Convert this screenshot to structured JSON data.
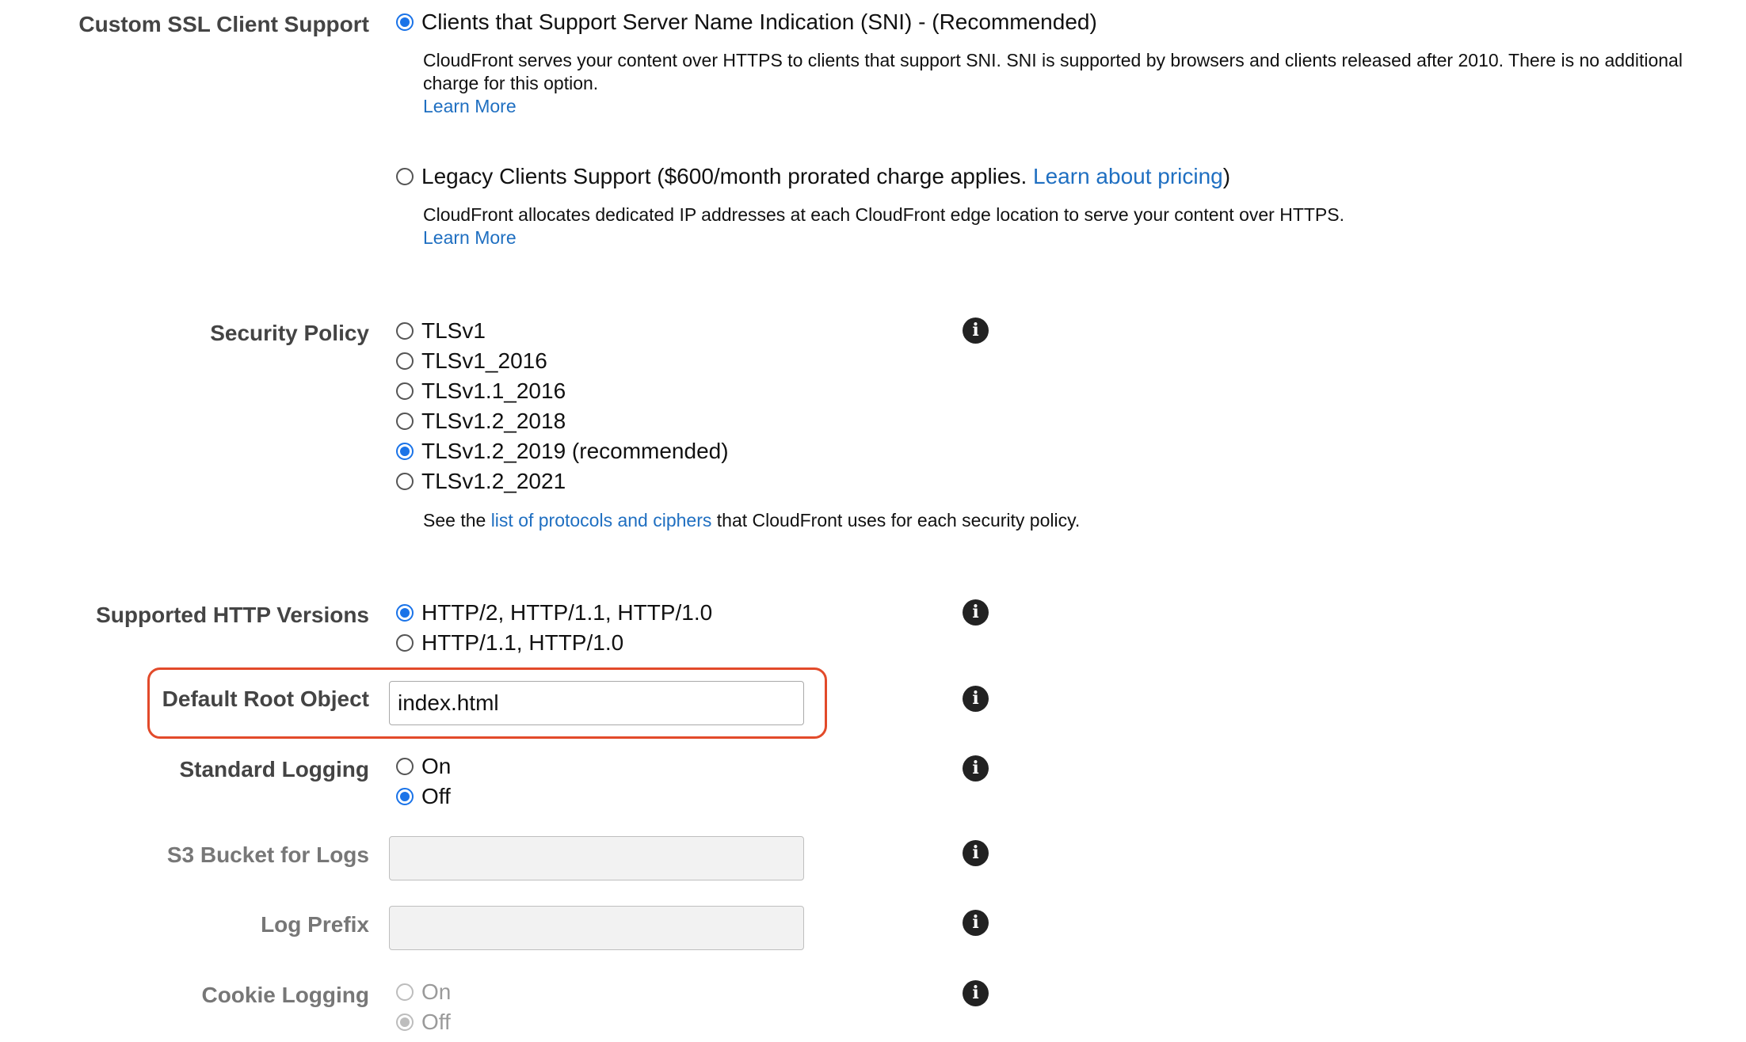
{
  "ssl_support": {
    "label": "Custom SSL Client Support",
    "sni_option": "Clients that Support Server Name Indication (SNI) - (Recommended)",
    "sni_desc": "CloudFront serves your content over HTTPS to clients that support SNI. SNI is supported by browsers and clients released after 2010. There is no additional charge for this option.",
    "sni_learn_more": "Learn More",
    "legacy_option_prefix": "Legacy Clients Support ($600/month prorated charge applies. ",
    "legacy_pricing_link": "Learn about pricing",
    "legacy_option_suffix": ")",
    "legacy_desc": "CloudFront allocates dedicated IP addresses at each CloudFront edge location to serve your content over HTTPS.",
    "legacy_learn_more": "Learn More",
    "selected": "sni"
  },
  "security_policy": {
    "label": "Security Policy",
    "options": [
      "TLSv1",
      "TLSv1_2016",
      "TLSv1.1_2016",
      "TLSv1.2_2018",
      "TLSv1.2_2019 (recommended)",
      "TLSv1.2_2021"
    ],
    "selected": "TLSv1.2_2019 (recommended)",
    "note_prefix": "See the ",
    "note_link": "list of protocols and ciphers",
    "note_suffix": " that CloudFront uses for each security policy."
  },
  "http_versions": {
    "label": "Supported HTTP Versions",
    "options": [
      "HTTP/2, HTTP/1.1, HTTP/1.0",
      "HTTP/1.1, HTTP/1.0"
    ],
    "selected": "HTTP/2, HTTP/1.1, HTTP/1.0"
  },
  "default_root_object": {
    "label": "Default Root Object",
    "value": "index.html"
  },
  "standard_logging": {
    "label": "Standard Logging",
    "on": "On",
    "off": "Off",
    "selected": "Off"
  },
  "s3_bucket": {
    "label": "S3 Bucket for Logs",
    "value": ""
  },
  "log_prefix": {
    "label": "Log Prefix",
    "value": ""
  },
  "cookie_logging": {
    "label": "Cookie Logging",
    "on": "On",
    "off": "Off",
    "selected": "Off"
  },
  "info_icon_glyph": "i",
  "colors": {
    "accent": "#1a73e8",
    "link": "#1f6fc1",
    "highlight": "#e24a2a"
  }
}
